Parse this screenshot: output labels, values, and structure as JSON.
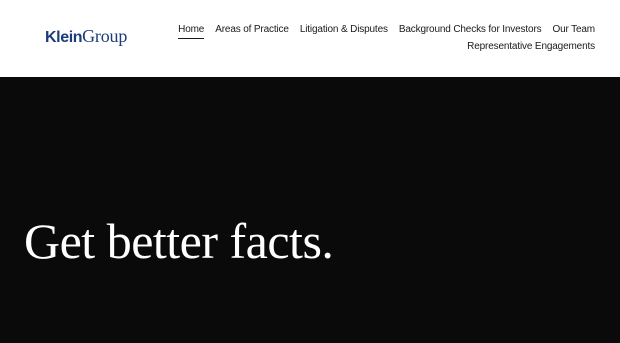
{
  "brand": {
    "name_part1": "Klein",
    "name_part2": "Group",
    "color": "#1c3c78"
  },
  "nav": {
    "items": [
      {
        "label": "Home",
        "active": true
      },
      {
        "label": "Areas of Practice"
      },
      {
        "label": "Litigation & Disputes"
      },
      {
        "label": "Background Checks for Investors"
      },
      {
        "label": "Our Team"
      },
      {
        "label": "Representative Engagements"
      }
    ]
  },
  "hero": {
    "heading": "Get better facts.",
    "background": "#0a0a0a"
  }
}
